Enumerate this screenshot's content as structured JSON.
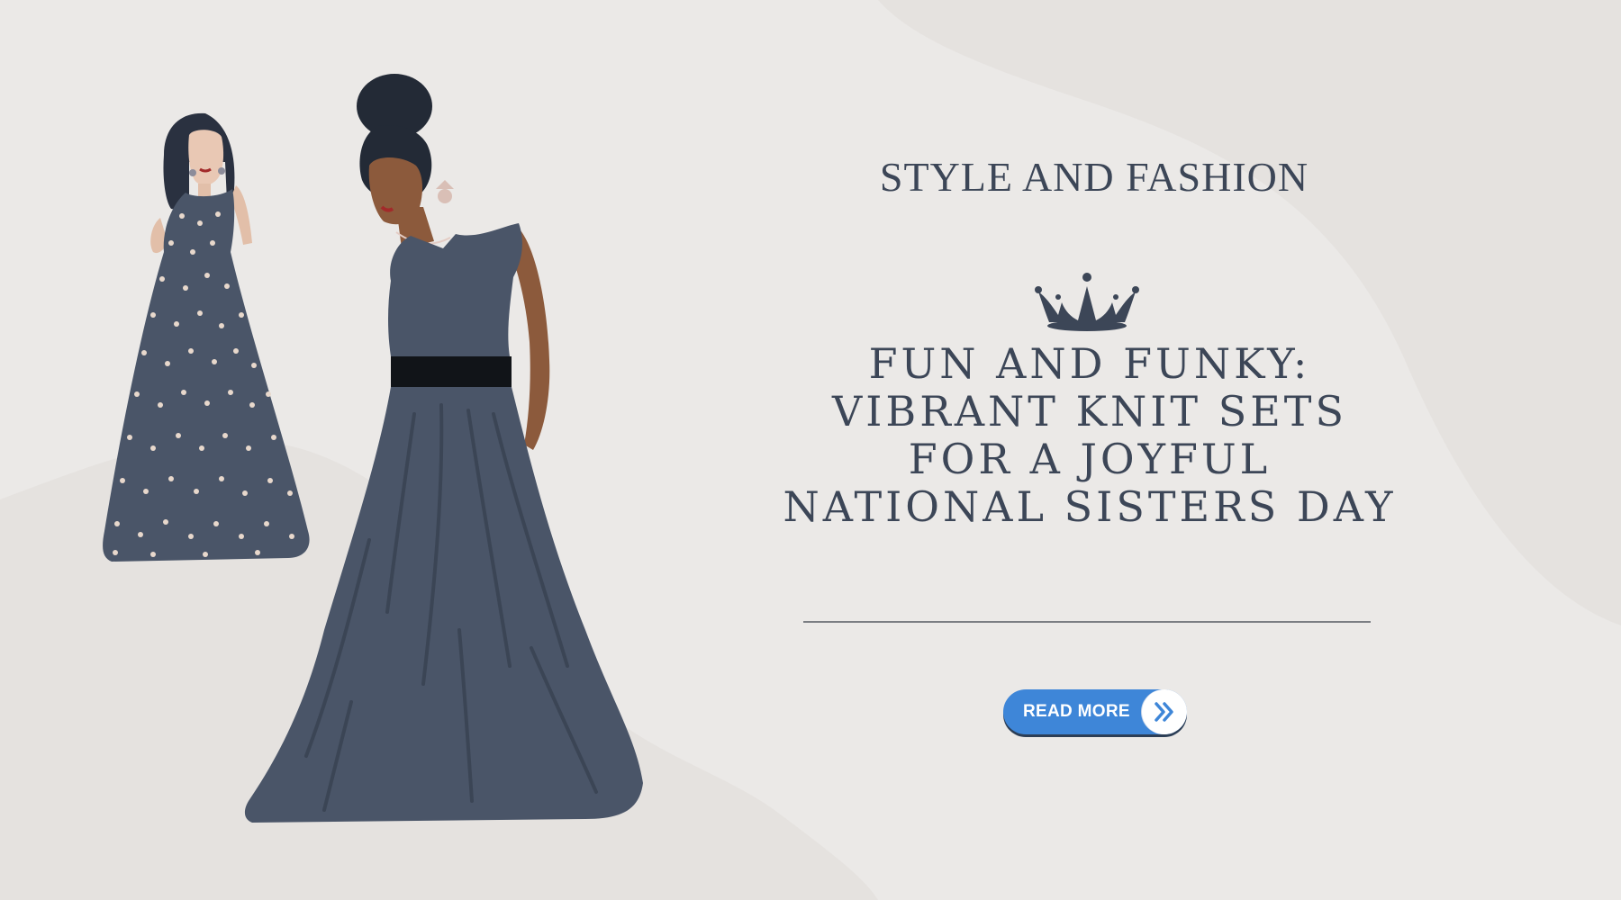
{
  "banner": {
    "category": "STYLE  AND FASHION",
    "headline": [
      "FUN AND FUNKY:",
      "VIBRANT KNIT SETS",
      "FOR A JOYFUL",
      "NATIONAL SISTERS DAY"
    ],
    "button_label": "READ MORE"
  },
  "icons": {
    "crown": "crown-icon",
    "button_arrow": "double-chevron-right-icon"
  },
  "colors": {
    "background": "#ebe9e7",
    "text": "#3c4657",
    "dress": "#4a5568",
    "button": "#3e86d8"
  }
}
